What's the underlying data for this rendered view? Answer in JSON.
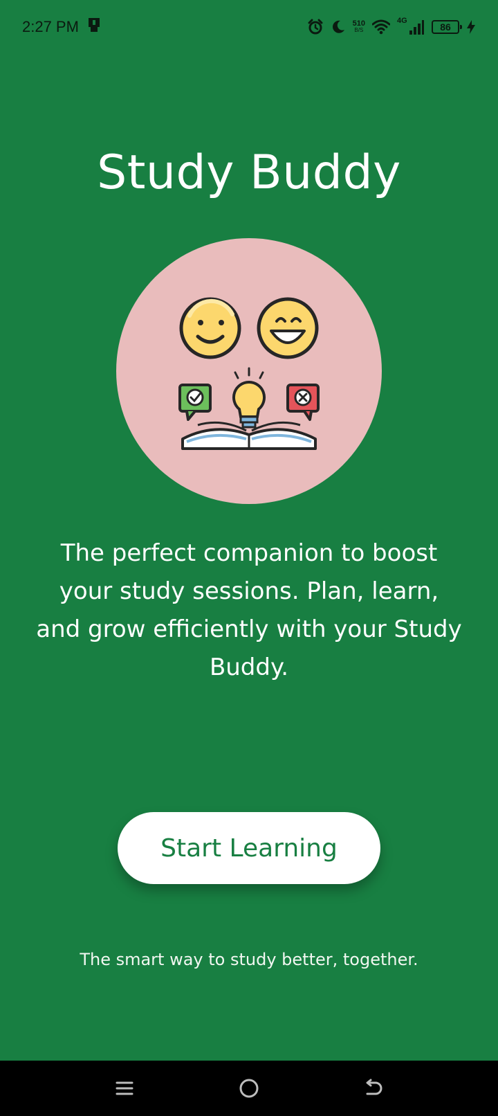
{
  "status_bar": {
    "time": "2:27 PM",
    "net_speed_value": "510",
    "net_speed_unit": "B/S",
    "network_type": "4G",
    "battery_level": "86",
    "icons": [
      "notification-icon",
      "alarm-icon",
      "moon-icon",
      "wifi-icon",
      "signal-icon",
      "battery-icon",
      "charging-icon"
    ]
  },
  "app": {
    "title": "Study Buddy",
    "description": "The perfect companion to boost your study sessions. Plan, learn, and grow efficiently with your Study Buddy.",
    "start_button_label": "Start Learning",
    "tagline": "The smart way to study better, together.",
    "hero_illustration": "study-buddy-illustration"
  },
  "nav_bar": {
    "icons": [
      "menu-icon",
      "home-icon",
      "back-icon"
    ]
  },
  "colors": {
    "background": "#187f42",
    "hero_circle": "#e9bcbc",
    "button_background": "#ffffff",
    "button_text": "#187f42"
  }
}
